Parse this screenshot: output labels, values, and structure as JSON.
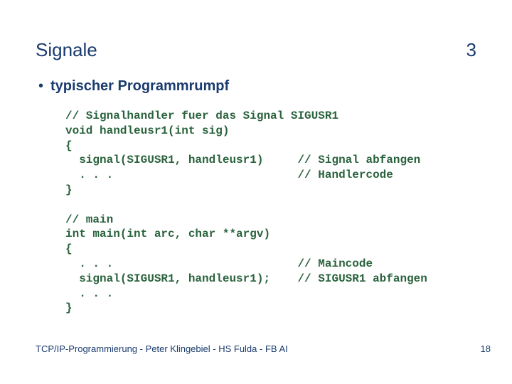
{
  "header": {
    "title": "Signale",
    "number": "3"
  },
  "bullet": {
    "label": "typischer Programmrumpf"
  },
  "code": "// Signalhandler fuer das Signal SIGUSR1\nvoid handleusr1(int sig)\n{\n  signal(SIGUSR1, handleusr1)     // Signal abfangen\n  . . .                           // Handlercode\n}\n\n// main\nint main(int arc, char **argv)\n{\n  . . .                           // Maincode\n  signal(SIGUSR1, handleusr1);    // SIGUSR1 abfangen\n  . . .\n}",
  "footer": {
    "text": "TCP/IP-Programmierung - Peter Klingebiel - HS Fulda - FB AI",
    "page": "18"
  }
}
